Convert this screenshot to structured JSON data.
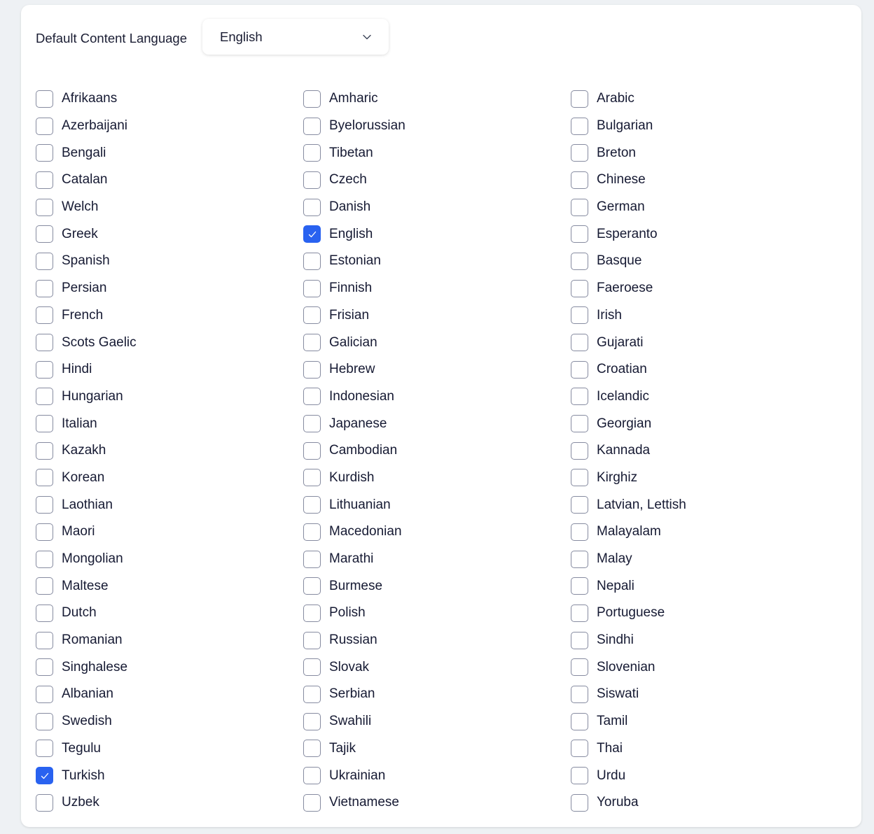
{
  "default_language": {
    "label": "Default Content Language",
    "selected": "English"
  },
  "colors": {
    "accent": "#2962f0"
  },
  "columns": [
    [
      {
        "label": "Afrikaans",
        "checked": false
      },
      {
        "label": "Azerbaijani",
        "checked": false
      },
      {
        "label": "Bengali",
        "checked": false
      },
      {
        "label": "Catalan",
        "checked": false
      },
      {
        "label": "Welch",
        "checked": false
      },
      {
        "label": "Greek",
        "checked": false
      },
      {
        "label": "Spanish",
        "checked": false
      },
      {
        "label": "Persian",
        "checked": false
      },
      {
        "label": "French",
        "checked": false
      },
      {
        "label": "Scots Gaelic",
        "checked": false
      },
      {
        "label": "Hindi",
        "checked": false
      },
      {
        "label": "Hungarian",
        "checked": false
      },
      {
        "label": "Italian",
        "checked": false
      },
      {
        "label": "Kazakh",
        "checked": false
      },
      {
        "label": "Korean",
        "checked": false
      },
      {
        "label": "Laothian",
        "checked": false
      },
      {
        "label": "Maori",
        "checked": false
      },
      {
        "label": "Mongolian",
        "checked": false
      },
      {
        "label": "Maltese",
        "checked": false
      },
      {
        "label": "Dutch",
        "checked": false
      },
      {
        "label": "Romanian",
        "checked": false
      },
      {
        "label": "Singhalese",
        "checked": false
      },
      {
        "label": "Albanian",
        "checked": false
      },
      {
        "label": "Swedish",
        "checked": false
      },
      {
        "label": "Tegulu",
        "checked": false
      },
      {
        "label": "Turkish",
        "checked": true
      },
      {
        "label": "Uzbek",
        "checked": false
      }
    ],
    [
      {
        "label": "Amharic",
        "checked": false
      },
      {
        "label": "Byelorussian",
        "checked": false
      },
      {
        "label": "Tibetan",
        "checked": false
      },
      {
        "label": "Czech",
        "checked": false
      },
      {
        "label": "Danish",
        "checked": false
      },
      {
        "label": "English",
        "checked": true
      },
      {
        "label": "Estonian",
        "checked": false
      },
      {
        "label": "Finnish",
        "checked": false
      },
      {
        "label": "Frisian",
        "checked": false
      },
      {
        "label": "Galician",
        "checked": false
      },
      {
        "label": "Hebrew",
        "checked": false
      },
      {
        "label": "Indonesian",
        "checked": false
      },
      {
        "label": "Japanese",
        "checked": false
      },
      {
        "label": "Cambodian",
        "checked": false
      },
      {
        "label": "Kurdish",
        "checked": false
      },
      {
        "label": "Lithuanian",
        "checked": false
      },
      {
        "label": "Macedonian",
        "checked": false
      },
      {
        "label": "Marathi",
        "checked": false
      },
      {
        "label": "Burmese",
        "checked": false
      },
      {
        "label": "Polish",
        "checked": false
      },
      {
        "label": "Russian",
        "checked": false
      },
      {
        "label": "Slovak",
        "checked": false
      },
      {
        "label": "Serbian",
        "checked": false
      },
      {
        "label": "Swahili",
        "checked": false
      },
      {
        "label": "Tajik",
        "checked": false
      },
      {
        "label": "Ukrainian",
        "checked": false
      },
      {
        "label": "Vietnamese",
        "checked": false
      }
    ],
    [
      {
        "label": "Arabic",
        "checked": false
      },
      {
        "label": "Bulgarian",
        "checked": false
      },
      {
        "label": "Breton",
        "checked": false
      },
      {
        "label": "Chinese",
        "checked": false
      },
      {
        "label": "German",
        "checked": false
      },
      {
        "label": "Esperanto",
        "checked": false
      },
      {
        "label": "Basque",
        "checked": false
      },
      {
        "label": "Faeroese",
        "checked": false
      },
      {
        "label": "Irish",
        "checked": false
      },
      {
        "label": "Gujarati",
        "checked": false
      },
      {
        "label": "Croatian",
        "checked": false
      },
      {
        "label": "Icelandic",
        "checked": false
      },
      {
        "label": "Georgian",
        "checked": false
      },
      {
        "label": "Kannada",
        "checked": false
      },
      {
        "label": "Kirghiz",
        "checked": false
      },
      {
        "label": "Latvian, Lettish",
        "checked": false
      },
      {
        "label": "Malayalam",
        "checked": false
      },
      {
        "label": "Malay",
        "checked": false
      },
      {
        "label": "Nepali",
        "checked": false
      },
      {
        "label": "Portuguese",
        "checked": false
      },
      {
        "label": "Sindhi",
        "checked": false
      },
      {
        "label": "Slovenian",
        "checked": false
      },
      {
        "label": "Siswati",
        "checked": false
      },
      {
        "label": "Tamil",
        "checked": false
      },
      {
        "label": "Thai",
        "checked": false
      },
      {
        "label": "Urdu",
        "checked": false
      },
      {
        "label": "Yoruba",
        "checked": false
      }
    ]
  ]
}
